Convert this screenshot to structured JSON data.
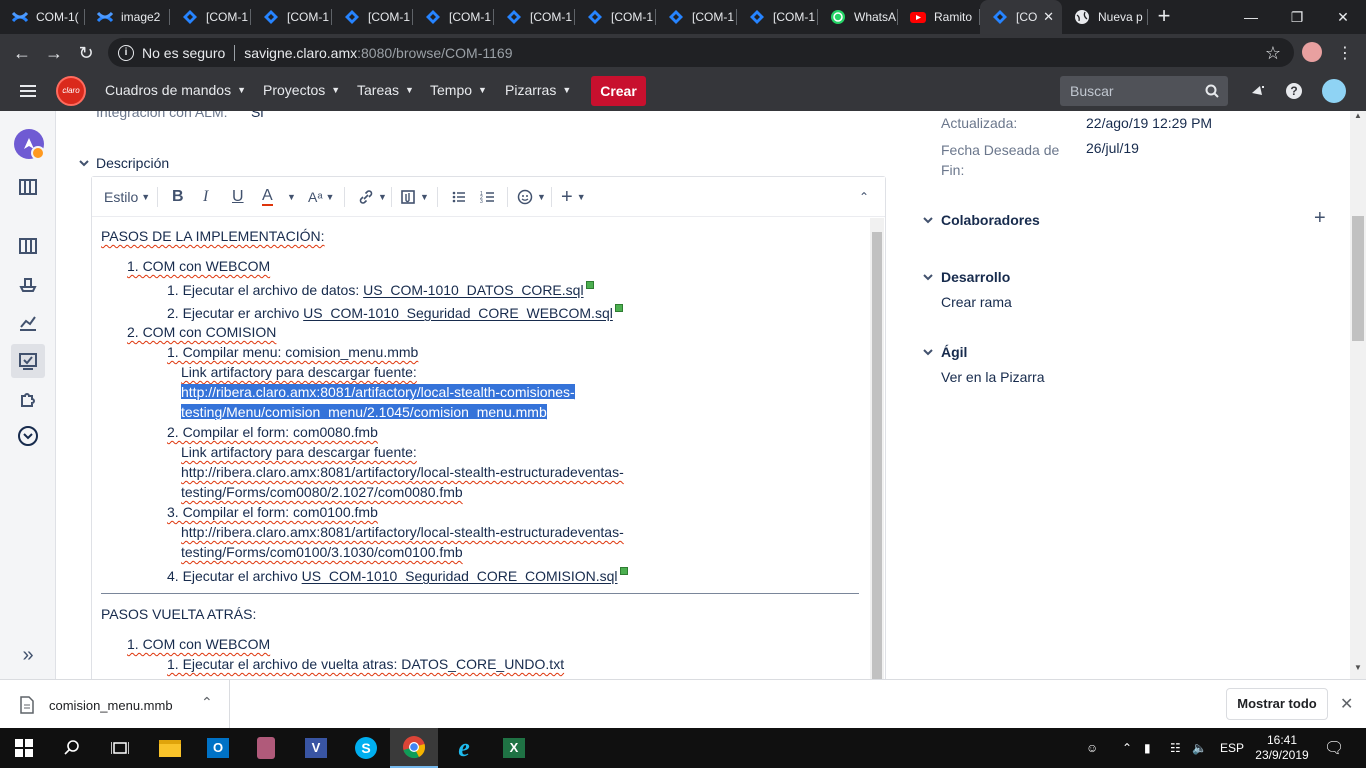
{
  "browser": {
    "tabs": [
      {
        "label": "COM-1(",
        "icon": "confluence-icon"
      },
      {
        "label": "image2",
        "icon": "confluence-icon"
      },
      {
        "label": "[COM-1",
        "icon": "jira-icon"
      },
      {
        "label": "[COM-1",
        "icon": "jira-icon"
      },
      {
        "label": "[COM-1",
        "icon": "jira-icon"
      },
      {
        "label": "[COM-1",
        "icon": "jira-icon"
      },
      {
        "label": "[COM-1",
        "icon": "jira-icon"
      },
      {
        "label": "[COM-1",
        "icon": "jira-icon"
      },
      {
        "label": "[COM-1",
        "icon": "jira-icon"
      },
      {
        "label": "[COM-1",
        "icon": "jira-icon"
      },
      {
        "label": "WhatsA",
        "icon": "whatsapp-icon"
      },
      {
        "label": "Ramito",
        "icon": "youtube-icon"
      },
      {
        "label": "[CO",
        "icon": "jira-icon",
        "active": true
      },
      {
        "label": "Nueva p",
        "icon": "globe-icon"
      }
    ],
    "new_tab": "+",
    "security": "No es seguro",
    "url_host": "savigne.claro.amx",
    "url_rest": ":8080/browse/COM-1169"
  },
  "jira_nav": {
    "logo": "claro",
    "menus": [
      "Cuadros de mandos",
      "Proyectos",
      "Tareas",
      "Tempo",
      "Pizarras"
    ],
    "create": "Crear",
    "search_placeholder": "Buscar"
  },
  "issue": {
    "alm_label": "Integración con ALM:",
    "alm_value": "Si",
    "description_title": "Descripción",
    "details": [
      {
        "label": "Actualizada:",
        "value": "22/ago/19 12:29 PM"
      },
      {
        "label": "Fecha Deseada de Fin:",
        "value": "26/jul/19"
      }
    ],
    "collaborators": "Colaboradores",
    "development": "Desarrollo",
    "create_branch": "Crear rama",
    "agile": "Ágil",
    "view_board": "Ver en la Pizarra"
  },
  "editor": {
    "style_label": "Estilo",
    "toolbar_icons": [
      "bold-icon",
      "italic-icon",
      "underline-icon",
      "text-color-icon",
      "text-format-icon",
      "link-icon",
      "attachment-icon",
      "bullet-list-icon",
      "numbered-list-icon",
      "emoji-icon",
      "insert-icon",
      "collapse-icon"
    ]
  },
  "doc": {
    "h1": "PASOS DE LA IMPLEMENTACIÓN:",
    "i1": "1. COM con WEBCOM",
    "i1a_pre": "1. Ejecutar el archivo de datos: ",
    "i1a_file": "US_COM-1010_DATOS_CORE.sql",
    "i1b_pre": "2. Ejecutar er archivo ",
    "i1b_file": "US_COM-1010_Seguridad_CORE_WEBCOM.sql",
    "i2": "2. COM con COMISION",
    "i2a": "1. Compilar menu: comision_menu.mmb",
    "i2a_link_label": "Link artifactory para descargar fuente:",
    "i2a_url1": "http://ribera.claro.amx:8081/artifactory/local-stealth-comisiones-",
    "i2a_url2": "testing/Menu/comision_menu/2.1045/comision_menu.mmb",
    "i2b": "2. Compilar el form: com0080.fmb",
    "i2b_link_label": "Link artifactory para descargar fuente:",
    "i2b_url1": "http://ribera.claro.amx:8081/artifactory/local-stealth-estructuradeventas-",
    "i2b_url2": "testing/Forms/com0080/2.1027/com0080.fmb",
    "i2c": "3. Compilar el form: com0100.fmb",
    "i2c_url1": "http://ribera.claro.amx:8081/artifactory/local-stealth-estructuradeventas-",
    "i2c_url2": "testing/Forms/com0100/3.1030/com0100.fmb",
    "i2d_pre": "4. Ejecutar el archivo ",
    "i2d_file": "US_COM-1010_Seguridad_CORE_COMISION.sql",
    "h2": "PASOS VUELTA ATRÁS:",
    "r1": "1. COM con WEBCOM",
    "r1a": "1. Ejecutar el archivo de vuelta atras: DATOS_CORE_UNDO.txt"
  },
  "download": {
    "file": "comision_menu.mmb",
    "show_all": "Mostrar todo"
  },
  "taskbar": {
    "lang": "ESP",
    "time": "16:41",
    "date": "23/9/2019"
  },
  "colors": {
    "brand_red": "#c8102e",
    "selection": "#3573d9",
    "chrome_dark": "#202124",
    "chrome_mid": "#35363a"
  }
}
